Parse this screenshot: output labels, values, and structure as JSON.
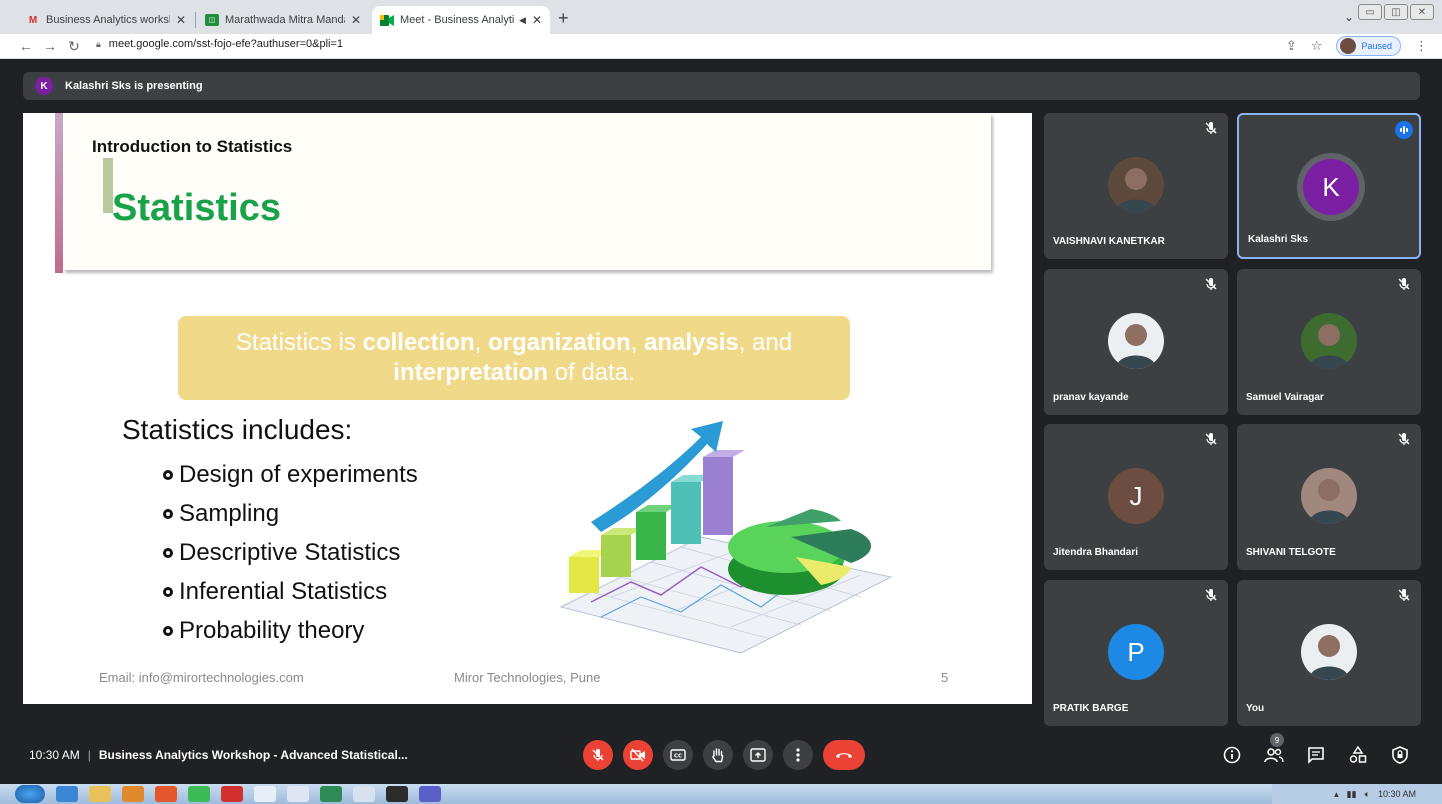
{
  "browser": {
    "tabs": [
      {
        "title": "Business Analytics workshop join",
        "icon": "gmail-icon",
        "active": false
      },
      {
        "title": "Marathwada Mitra Mandal's Insti",
        "icon": "classroom-icon",
        "active": false
      },
      {
        "title": "Meet - Business Analytics W",
        "icon": "meet-icon",
        "active": true
      }
    ],
    "new_tab": "+",
    "url": "meet.google.com/sst-fojo-efe?authuser=0&pli=1",
    "profile_status": "Paused"
  },
  "meet": {
    "presenting_initial": "K",
    "presenting_text": "Kalashri Sks is presenting",
    "slide": {
      "subtitle": "Introduction to Statistics",
      "title": "Statistics",
      "definition_parts": [
        {
          "text": "Statistics is ",
          "bold": false
        },
        {
          "text": "collection",
          "bold": true
        },
        {
          "text": ", ",
          "bold": false
        },
        {
          "text": "organization",
          "bold": true
        },
        {
          "text": ", ",
          "bold": false
        },
        {
          "text": "analysis",
          "bold": true
        },
        {
          "text": ", and ",
          "bold": false
        },
        {
          "text": "interpretation",
          "bold": true
        },
        {
          "text": " of data.",
          "bold": false
        }
      ],
      "includes_heading": "Statistics includes:",
      "bullets": [
        "Design of experiments",
        "Sampling",
        "Descriptive Statistics",
        "Inferential Statistics",
        "Probability theory"
      ],
      "footer_email": "Email: info@mirortechnologies.com",
      "footer_company": "Miror Technologies, Pune",
      "page_number": "5"
    },
    "participants": [
      {
        "name": "VAISHNAVI KANETKAR",
        "avatar": "photo",
        "avatar_color": "#5d4a3c",
        "muted": true,
        "speaking": false
      },
      {
        "name": "Kalashri Sks",
        "avatar": "K",
        "avatar_color": "#7b1fa2",
        "muted": false,
        "speaking": true
      },
      {
        "name": "pranav kayande",
        "avatar": "photo",
        "avatar_color": "#eceff1",
        "muted": true,
        "speaking": false
      },
      {
        "name": "Samuel Vairagar",
        "avatar": "photo",
        "avatar_color": "#3e6b2f",
        "muted": true,
        "speaking": false
      },
      {
        "name": "Jitendra Bhandari",
        "avatar": "J",
        "avatar_color": "#6d4c41",
        "muted": true,
        "speaking": false
      },
      {
        "name": "SHIVANI TELGOTE",
        "avatar": "photo",
        "avatar_color": "#a1887f",
        "muted": true,
        "speaking": false
      },
      {
        "name": "PRATIK BARGE",
        "avatar": "P",
        "avatar_color": "#1e88e5",
        "muted": true,
        "speaking": false
      },
      {
        "name": "You",
        "avatar": "photo",
        "avatar_color": "#eceff1",
        "muted": true,
        "speaking": false
      }
    ],
    "bottom": {
      "time": "10:30 AM",
      "separator": "|",
      "meeting_title": "Business Analytics Workshop - Advanced Statistical...",
      "people_count": "9"
    }
  },
  "taskbar": {
    "clock": "10:30 AM"
  },
  "colors": {
    "meet_bg": "#202124",
    "tile_bg": "#3c4043",
    "danger": "#ea4335",
    "accent": "#1a73e8",
    "slide_green": "#18a24a"
  }
}
